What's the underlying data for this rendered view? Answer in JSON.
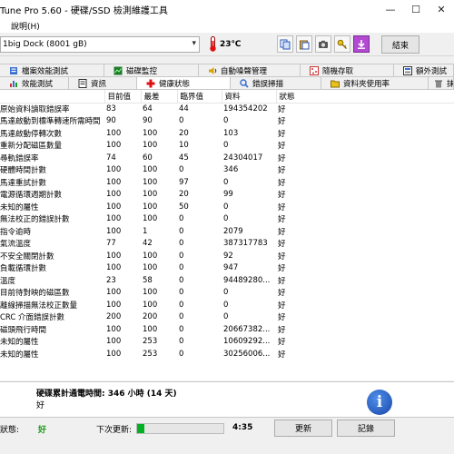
{
  "window": {
    "title": "Tune Pro 5.60 - 硬碟/SSD 檢測維護工具",
    "controls": [
      "—",
      "☐",
      "✕"
    ]
  },
  "menu": {
    "items": [
      "說明(H)"
    ]
  },
  "toolbar": {
    "drive": "1big Dock (8001 gB)",
    "temperature": "23℃",
    "exit_label": "結束",
    "icons": [
      "copy-icon",
      "paste-icon",
      "camera-icon",
      "key-icon",
      "download-icon"
    ]
  },
  "tabs": {
    "row1": [
      {
        "label": "檔案效能測試",
        "icon": "file-benchmark-icon"
      },
      {
        "label": "磁碟監控",
        "icon": "disk-monitor-icon"
      },
      {
        "label": "自動噪聲管理",
        "icon": "speaker-icon"
      },
      {
        "label": "隨機存取",
        "icon": "random-access-icon"
      },
      {
        "label": "額外測試",
        "icon": "extra-tests-icon"
      }
    ],
    "row2": [
      {
        "label": "效能測試",
        "icon": "benchmark-icon"
      },
      {
        "label": "資訊",
        "icon": "info-tab-icon"
      },
      {
        "label": "健康狀態",
        "icon": "health-icon"
      },
      {
        "label": "錯誤掃描",
        "icon": "error-scan-icon"
      },
      {
        "label": "資料夾使用率",
        "icon": "folder-usage-icon"
      },
      {
        "label": "抹除",
        "icon": "erase-icon"
      }
    ]
  },
  "table": {
    "columns": [
      "",
      "目前值",
      "最差",
      "臨界值",
      "資料",
      "狀態"
    ],
    "rows": [
      [
        "原始資料讀取錯誤率",
        "83",
        "64",
        "44",
        "194354202",
        "好"
      ],
      [
        "馬達啟動到標準轉速所需時間",
        "90",
        "90",
        "0",
        "0",
        "好"
      ],
      [
        "馬達啟動停轉次數",
        "100",
        "100",
        "20",
        "103",
        "好"
      ],
      [
        "重新分配磁區數量",
        "100",
        "100",
        "10",
        "0",
        "好"
      ],
      [
        "尋軌錯誤率",
        "74",
        "60",
        "45",
        "24304017",
        "好"
      ],
      [
        "硬體時間計數",
        "100",
        "100",
        "0",
        "346",
        "好"
      ],
      [
        "馬達重試計數",
        "100",
        "100",
        "97",
        "0",
        "好"
      ],
      [
        "電源循環週期計數",
        "100",
        "100",
        "20",
        "99",
        "好"
      ],
      [
        "未知的屬性",
        "100",
        "100",
        "50",
        "0",
        "好"
      ],
      [
        "無法校正的錯誤計數",
        "100",
        "100",
        "0",
        "0",
        "好"
      ],
      [
        "指令逾時",
        "100",
        "1",
        "0",
        "2079",
        "好"
      ],
      [
        "氣流溫度",
        "77",
        "42",
        "0",
        "387317783",
        "好"
      ],
      [
        "不安全關閉計數",
        "100",
        "100",
        "0",
        "92",
        "好"
      ],
      [
        "負載循環計數",
        "100",
        "100",
        "0",
        "947",
        "好"
      ],
      [
        "溫度",
        "23",
        "58",
        "0",
        "94489280...",
        "好"
      ],
      [
        "目前待對映的磁區數",
        "100",
        "100",
        "0",
        "0",
        "好"
      ],
      [
        "離線掃描無法校正數量",
        "100",
        "100",
        "0",
        "0",
        "好"
      ],
      [
        "CRC 介面錯誤計數",
        "200",
        "200",
        "0",
        "0",
        "好"
      ],
      [
        "磁頭飛行時間",
        "100",
        "100",
        "0",
        "20667382...",
        "好"
      ],
      [
        "未知的屬性",
        "100",
        "253",
        "0",
        "10609292...",
        "好"
      ],
      [
        "未知的屬性",
        "100",
        "253",
        "0",
        "30256006...",
        "好"
      ]
    ]
  },
  "status": {
    "power_on": "硬碟累計通電時間: 346 小時 (14 天)",
    "overall": "好"
  },
  "footer": {
    "health_label": "狀態:",
    "health_value": "好",
    "next_update_label": "下次更新:",
    "progress_fraction": 0.08,
    "countdown": "4:35",
    "update_button": "更新",
    "log_button": "記錄"
  },
  "colors": {
    "header_blue": "#0b3a8a",
    "good_green": "#1d9a1d",
    "progress_green": "#06b025",
    "row_dot": "#5b6fbf"
  }
}
